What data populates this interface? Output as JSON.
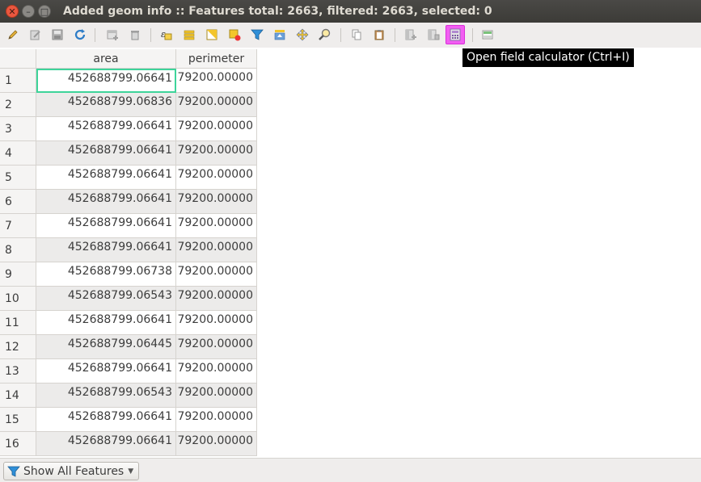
{
  "window": {
    "title": "Added geom info :: Features total: 2663, filtered: 2663, selected: 0"
  },
  "toolbar": {
    "buttons": [
      {
        "name": "toggle-editing",
        "icon": "pencil-icon"
      },
      {
        "name": "toggle-multi-edit",
        "icon": "multi-edit-icon"
      },
      {
        "name": "save-edits",
        "icon": "save-icon"
      },
      {
        "name": "reload",
        "icon": "refresh-icon"
      },
      {
        "name": "add-feature",
        "icon": "add-feature-icon"
      },
      {
        "name": "delete-selected",
        "icon": "trash-icon"
      },
      {
        "name": "select-by-expression",
        "icon": "expression-select-icon"
      },
      {
        "name": "select-all",
        "icon": "select-all-icon"
      },
      {
        "name": "invert-selection",
        "icon": "invert-selection-icon"
      },
      {
        "name": "deselect-all",
        "icon": "deselect-icon"
      },
      {
        "name": "filter-select",
        "icon": "filter-icon"
      },
      {
        "name": "move-selection-top",
        "icon": "move-top-icon"
      },
      {
        "name": "pan-to-selection",
        "icon": "pan-icon"
      },
      {
        "name": "zoom-to-selection",
        "icon": "zoom-icon"
      },
      {
        "name": "copy-rows",
        "icon": "copy-icon"
      },
      {
        "name": "paste-features",
        "icon": "paste-icon"
      },
      {
        "name": "new-field",
        "icon": "new-field-icon"
      },
      {
        "name": "delete-field",
        "icon": "delete-field-icon"
      },
      {
        "name": "field-calculator",
        "icon": "calculator-icon"
      },
      {
        "name": "conditional-formatting",
        "icon": "conditional-format-icon"
      }
    ],
    "tooltip": "Open field calculator (Ctrl+I)"
  },
  "table": {
    "columns": [
      "area",
      "perimeter"
    ],
    "rows": [
      {
        "id": "1",
        "area": "452688799.06641",
        "perimeter": "79200.00000"
      },
      {
        "id": "2",
        "area": "452688799.06836",
        "perimeter": "79200.00000"
      },
      {
        "id": "3",
        "area": "452688799.06641",
        "perimeter": "79200.00000"
      },
      {
        "id": "4",
        "area": "452688799.06641",
        "perimeter": "79200.00000"
      },
      {
        "id": "5",
        "area": "452688799.06641",
        "perimeter": "79200.00000"
      },
      {
        "id": "6",
        "area": "452688799.06641",
        "perimeter": "79200.00000"
      },
      {
        "id": "7",
        "area": "452688799.06641",
        "perimeter": "79200.00000"
      },
      {
        "id": "8",
        "area": "452688799.06641",
        "perimeter": "79200.00000"
      },
      {
        "id": "9",
        "area": "452688799.06738",
        "perimeter": "79200.00000"
      },
      {
        "id": "10",
        "area": "452688799.06543",
        "perimeter": "79200.00000"
      },
      {
        "id": "11",
        "area": "452688799.06641",
        "perimeter": "79200.00000"
      },
      {
        "id": "12",
        "area": "452688799.06445",
        "perimeter": "79200.00000"
      },
      {
        "id": "13",
        "area": "452688799.06641",
        "perimeter": "79200.00000"
      },
      {
        "id": "14",
        "area": "452688799.06543",
        "perimeter": "79200.00000"
      },
      {
        "id": "15",
        "area": "452688799.06641",
        "perimeter": "79200.00000"
      },
      {
        "id": "16",
        "area": "452688799.06641",
        "perimeter": "79200.00000"
      }
    ]
  },
  "footer": {
    "filter_label": "Show All Features"
  }
}
